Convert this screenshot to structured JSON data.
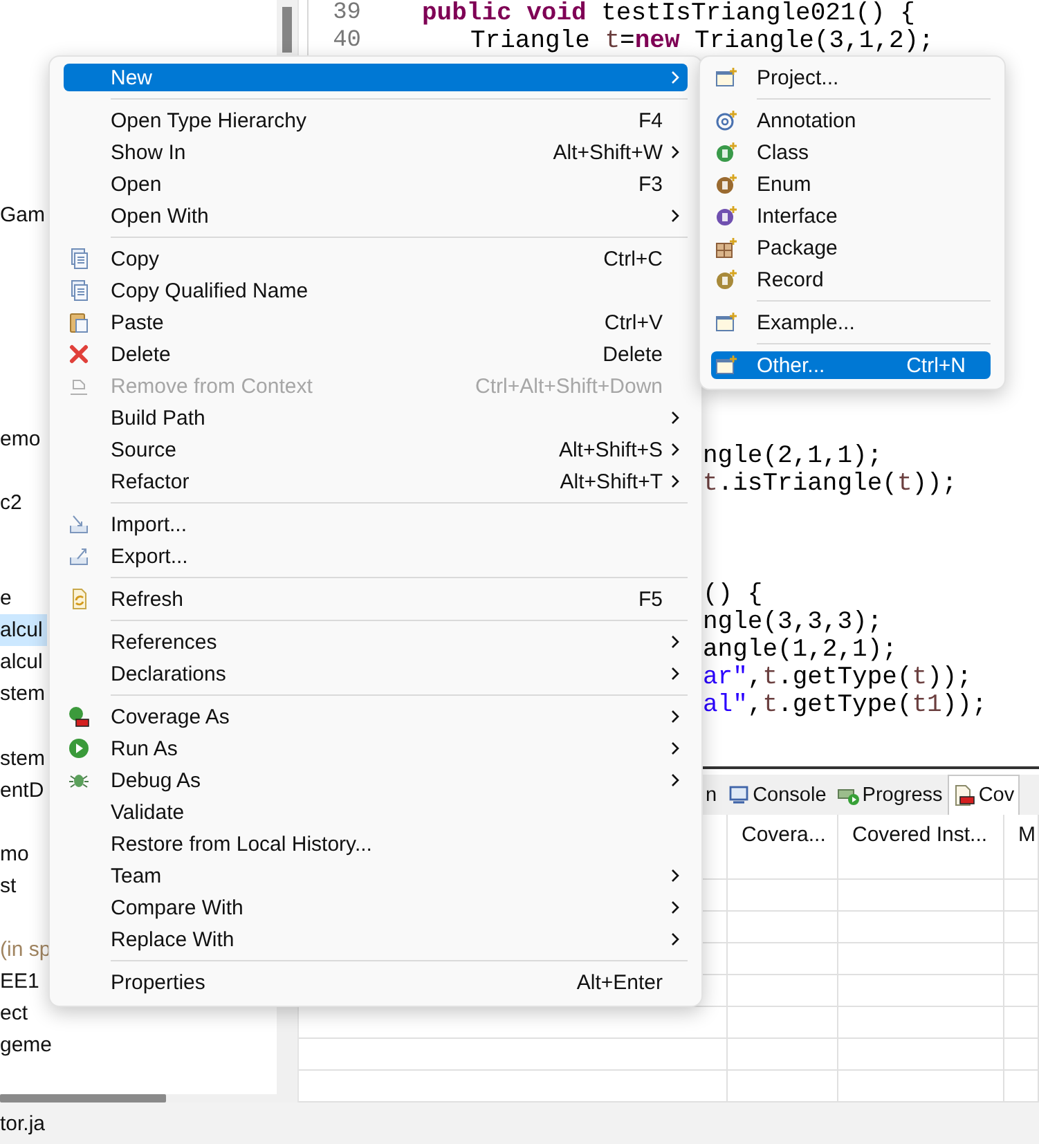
{
  "explorer": {
    "items": [
      {
        "text": "Gam",
        "kind": "name",
        "selected": false
      },
      {
        "text": "emo",
        "kind": "name",
        "selected": false
      },
      {
        "text": "c2",
        "kind": "name",
        "selected": false
      },
      {
        "text": "e",
        "kind": "name",
        "selected": false
      },
      {
        "text": "alcul",
        "kind": "name",
        "selected": true
      },
      {
        "text": "alcul",
        "kind": "name",
        "selected": false
      },
      {
        "text": "stem",
        "kind": "name",
        "selected": false
      },
      {
        "text": "stem",
        "kind": "name",
        "selected": false
      },
      {
        "text": "entD",
        "kind": "name",
        "selected": false
      },
      {
        "text": "mo",
        "kind": "name",
        "selected": false
      },
      {
        "text": "st",
        "kind": "name",
        "selected": false
      },
      {
        "text": "(in sp",
        "kind": "annotation",
        "selected": false
      },
      {
        "text": "EE1",
        "kind": "name",
        "selected": false
      },
      {
        "text": "ect",
        "kind": "name",
        "selected": false
      },
      {
        "text": "geme",
        "kind": "name",
        "selected": false
      }
    ],
    "footer_tab": "tor.ja"
  },
  "editor": {
    "line_numbers": [
      "39",
      "40"
    ],
    "code_lines": [
      [
        {
          "text": "public void",
          "kind": "keyword"
        },
        {
          "text": " testIsTriangle021() {",
          "kind": "plain"
        }
      ],
      [
        {
          "text": "Triangle ",
          "kind": "plain"
        },
        {
          "text": "t",
          "kind": "variable"
        },
        {
          "text": "=",
          "kind": "plain"
        },
        {
          "text": "new",
          "kind": "keyword"
        },
        {
          "text": " Triangle(3,1,2);",
          "kind": "plain"
        }
      ],
      [
        {
          "text": "ngle(2,1,1);",
          "kind": "plain"
        }
      ],
      [
        {
          "text": "t",
          "kind": "variable"
        },
        {
          "text": ".isTriangle(",
          "kind": "plain"
        },
        {
          "text": "t",
          "kind": "variable"
        },
        {
          "text": "));",
          "kind": "plain"
        }
      ],
      [
        {
          "text": "() {",
          "kind": "plain"
        }
      ],
      [
        {
          "text": "ngle(3,3,3);",
          "kind": "plain"
        }
      ],
      [
        {
          "text": "angle(1,2,1);",
          "kind": "plain"
        }
      ],
      [
        {
          "text": "ar\"",
          "kind": "string"
        },
        {
          "text": ",",
          "kind": "plain"
        },
        {
          "text": "t",
          "kind": "variable"
        },
        {
          "text": ".getType(",
          "kind": "plain"
        },
        {
          "text": "t",
          "kind": "variable"
        },
        {
          "text": "));",
          "kind": "plain"
        }
      ],
      [
        {
          "text": "al\"",
          "kind": "string"
        },
        {
          "text": ",",
          "kind": "plain"
        },
        {
          "text": "t",
          "kind": "variable"
        },
        {
          "text": ".getType(",
          "kind": "plain"
        },
        {
          "text": "t1",
          "kind": "variable"
        },
        {
          "text": "));",
          "kind": "plain"
        }
      ]
    ]
  },
  "bottom_panel": {
    "tabs": [
      {
        "label": "n",
        "selected": false
      },
      {
        "label": "Console",
        "selected": false
      },
      {
        "label": "Progress",
        "selected": false
      },
      {
        "label": "Cov",
        "selected": true
      }
    ],
    "table": {
      "columns": [
        "Covera...",
        "Covered Inst...",
        "M"
      ]
    }
  },
  "menu": {
    "items": [
      {
        "kind": "item",
        "label": "New",
        "selected": true,
        "disabled": false,
        "submenu": true
      },
      {
        "kind": "separator"
      },
      {
        "kind": "item",
        "label": "Open Type Hierarchy",
        "shortcut": "F4",
        "selected": false,
        "disabled": false,
        "submenu": false
      },
      {
        "kind": "item",
        "label": "Show In",
        "shortcut": "Alt+Shift+W",
        "selected": false,
        "disabled": false,
        "submenu": true
      },
      {
        "kind": "item",
        "label": "Open",
        "shortcut": "F3",
        "selected": false,
        "disabled": false,
        "submenu": false
      },
      {
        "kind": "item",
        "label": "Open With",
        "selected": false,
        "disabled": false,
        "submenu": true
      },
      {
        "kind": "separator"
      },
      {
        "kind": "item",
        "label": "Copy",
        "shortcut": "Ctrl+C",
        "selected": false,
        "disabled": false,
        "submenu": false
      },
      {
        "kind": "item",
        "label": "Copy Qualified Name",
        "selected": false,
        "disabled": false,
        "submenu": false
      },
      {
        "kind": "item",
        "label": "Paste",
        "shortcut": "Ctrl+V",
        "selected": false,
        "disabled": false,
        "submenu": false
      },
      {
        "kind": "item",
        "label": "Delete",
        "shortcut": "Delete",
        "selected": false,
        "disabled": false,
        "submenu": false
      },
      {
        "kind": "item",
        "label": "Remove from Context",
        "shortcut": "Ctrl+Alt+Shift+Down",
        "selected": false,
        "disabled": true,
        "submenu": false
      },
      {
        "kind": "item",
        "label": "Build Path",
        "selected": false,
        "disabled": false,
        "submenu": true
      },
      {
        "kind": "item",
        "label": "Source",
        "shortcut": "Alt+Shift+S",
        "selected": false,
        "disabled": false,
        "submenu": true
      },
      {
        "kind": "item",
        "label": "Refactor",
        "shortcut": "Alt+Shift+T",
        "selected": false,
        "disabled": false,
        "submenu": true
      },
      {
        "kind": "separator"
      },
      {
        "kind": "item",
        "label": "Import...",
        "selected": false,
        "disabled": false,
        "submenu": false
      },
      {
        "kind": "item",
        "label": "Export...",
        "selected": false,
        "disabled": false,
        "submenu": false
      },
      {
        "kind": "separator"
      },
      {
        "kind": "item",
        "label": "Refresh",
        "shortcut": "F5",
        "selected": false,
        "disabled": false,
        "submenu": false
      },
      {
        "kind": "separator"
      },
      {
        "kind": "item",
        "label": "References",
        "selected": false,
        "disabled": false,
        "submenu": true
      },
      {
        "kind": "item",
        "label": "Declarations",
        "selected": false,
        "disabled": false,
        "submenu": true
      },
      {
        "kind": "separator"
      },
      {
        "kind": "item",
        "label": "Coverage As",
        "selected": false,
        "disabled": false,
        "submenu": true
      },
      {
        "kind": "item",
        "label": "Run As",
        "selected": false,
        "disabled": false,
        "submenu": true
      },
      {
        "kind": "item",
        "label": "Debug As",
        "selected": false,
        "disabled": false,
        "submenu": true
      },
      {
        "kind": "item",
        "label": "Validate",
        "selected": false,
        "disabled": false,
        "submenu": false
      },
      {
        "kind": "item",
        "label": "Restore from Local History...",
        "selected": false,
        "disabled": false,
        "submenu": false
      },
      {
        "kind": "item",
        "label": "Team",
        "selected": false,
        "disabled": false,
        "submenu": true
      },
      {
        "kind": "item",
        "label": "Compare With",
        "selected": false,
        "disabled": false,
        "submenu": true
      },
      {
        "kind": "item",
        "label": "Replace With",
        "selected": false,
        "disabled": false,
        "submenu": true
      },
      {
        "kind": "separator"
      },
      {
        "kind": "item",
        "label": "Properties",
        "shortcut": "Alt+Enter",
        "selected": false,
        "disabled": false,
        "submenu": false
      }
    ]
  },
  "submenu": {
    "items": [
      {
        "kind": "item",
        "label": "Project...",
        "selected": false
      },
      {
        "kind": "separator"
      },
      {
        "kind": "item",
        "label": "Annotation",
        "selected": false
      },
      {
        "kind": "item",
        "label": "Class",
        "selected": false
      },
      {
        "kind": "item",
        "label": "Enum",
        "selected": false
      },
      {
        "kind": "item",
        "label": "Interface",
        "selected": false
      },
      {
        "kind": "item",
        "label": "Package",
        "selected": false
      },
      {
        "kind": "item",
        "label": "Record",
        "selected": false
      },
      {
        "kind": "separator"
      },
      {
        "kind": "item",
        "label": "Example...",
        "selected": false
      },
      {
        "kind": "separator"
      },
      {
        "kind": "item",
        "label": "Other...",
        "shortcut": "Ctrl+N",
        "selected": true
      }
    ]
  }
}
